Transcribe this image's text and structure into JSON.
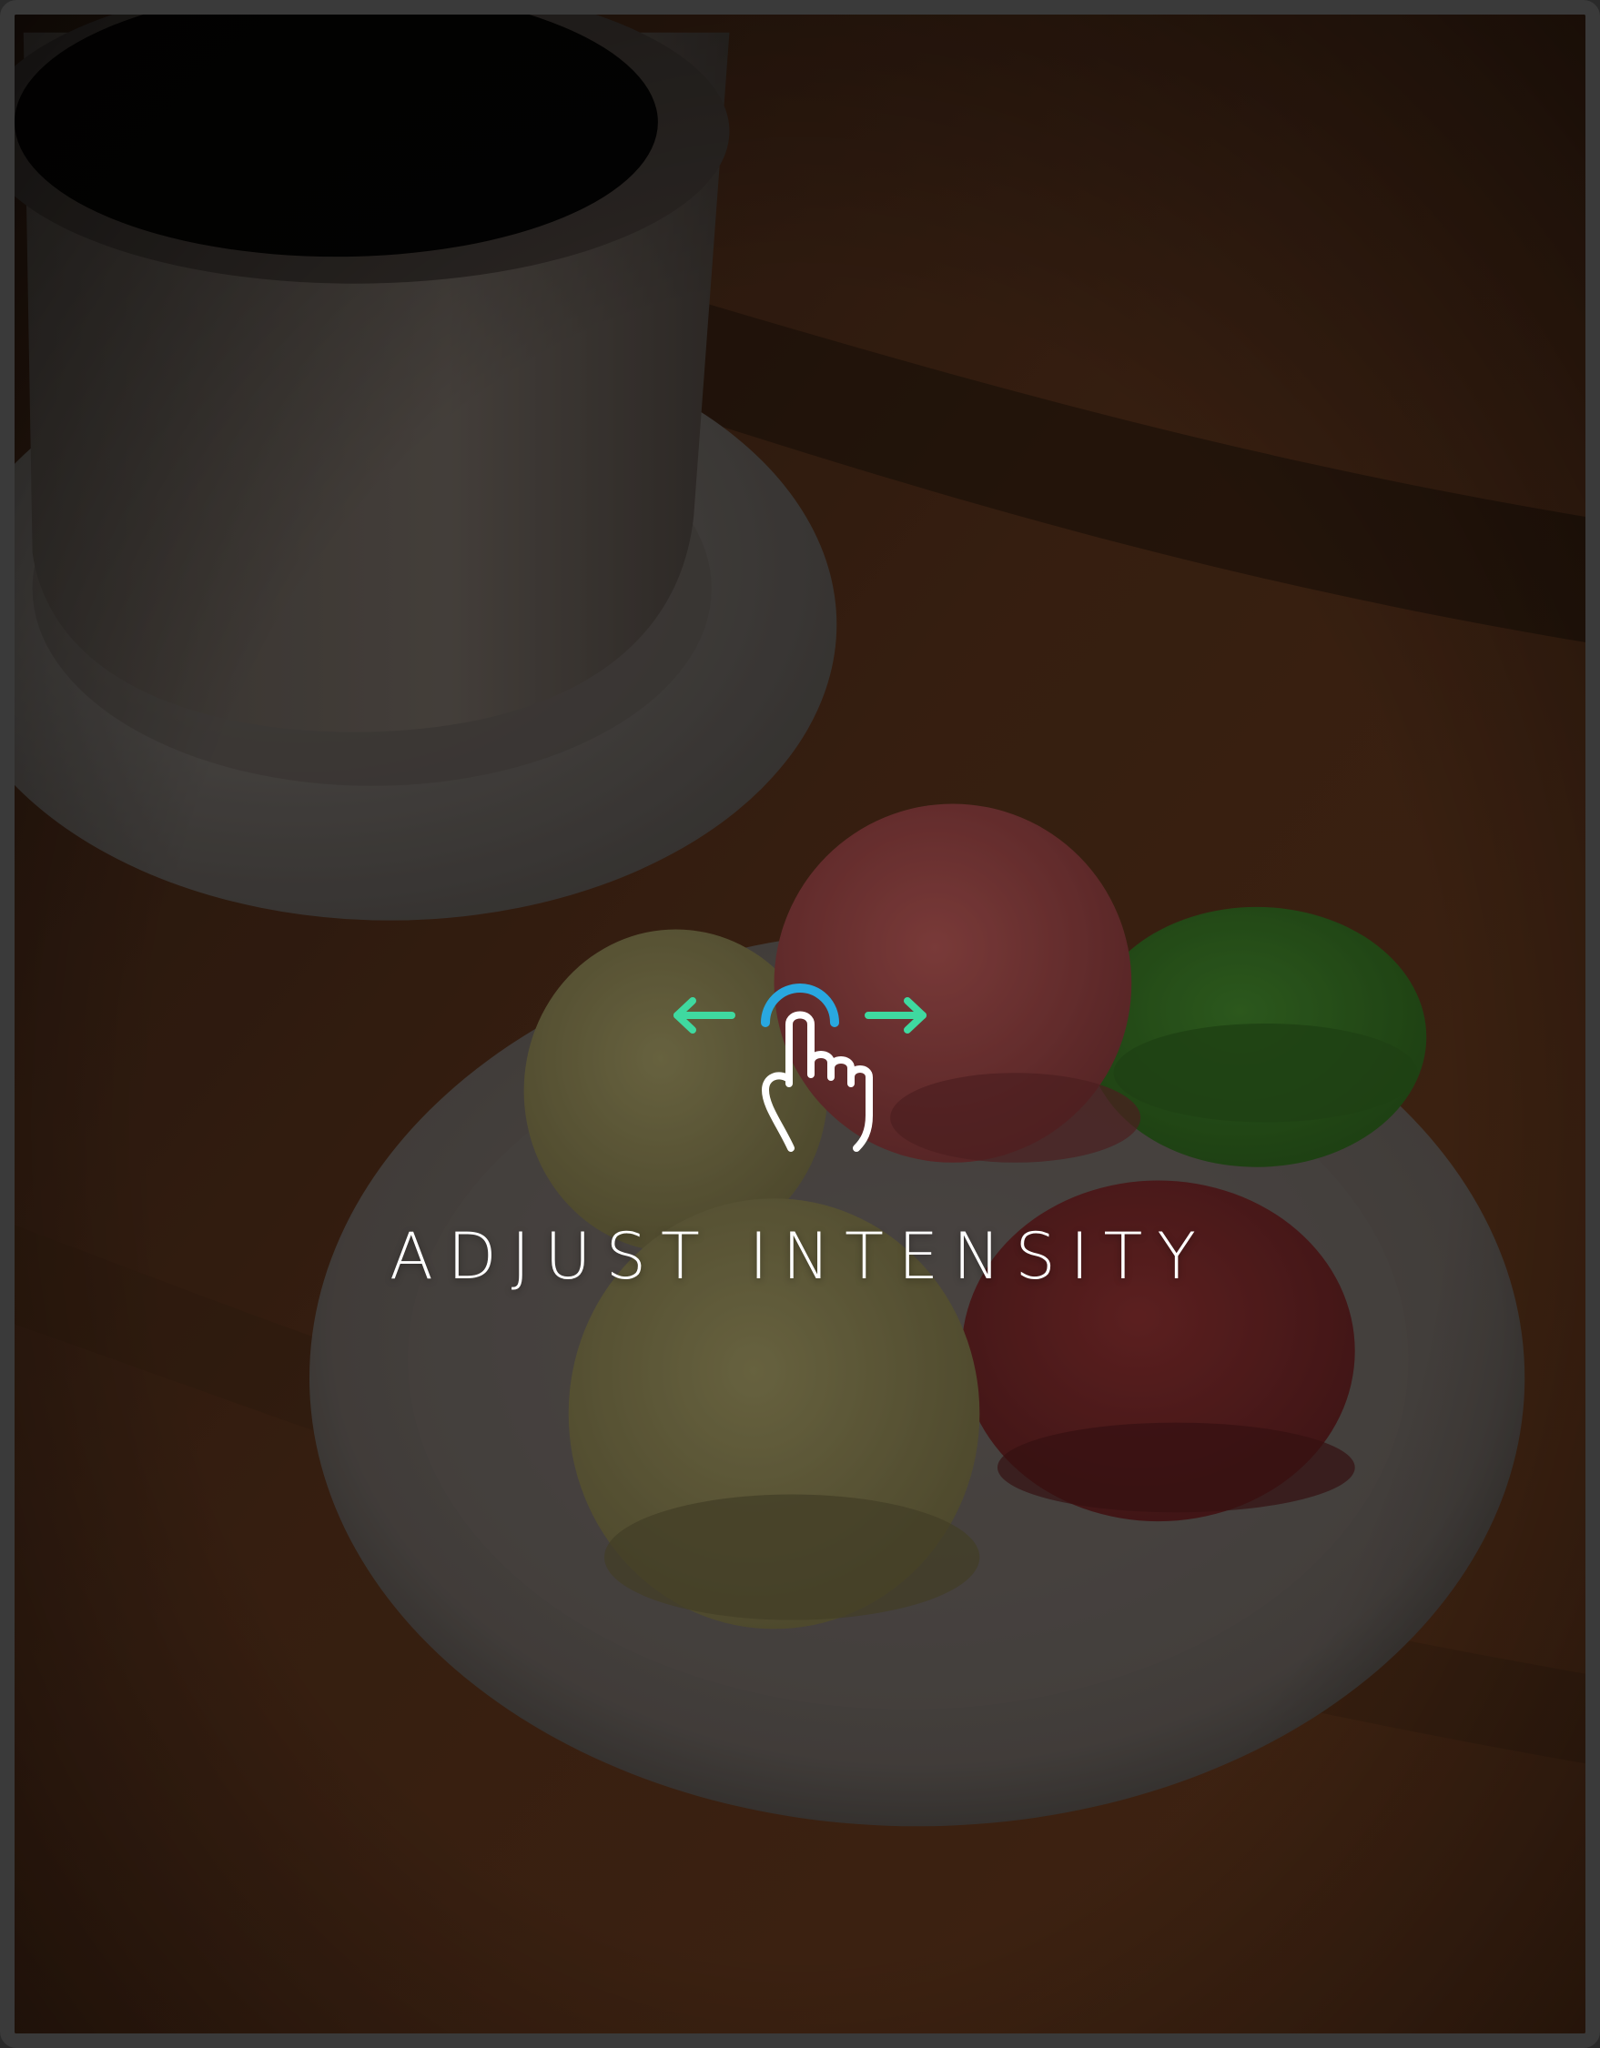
{
  "overlay": {
    "label": "ADJUST INTENSITY",
    "gesture_icon": "swipe-horizontal-hand-icon",
    "arrow_color": "#3fd9a0",
    "tap_ring_color": "#29a8e0",
    "hand_color": "#ffffff"
  },
  "photo": {
    "subject": "coffee-cup-and-macarons-icon"
  }
}
